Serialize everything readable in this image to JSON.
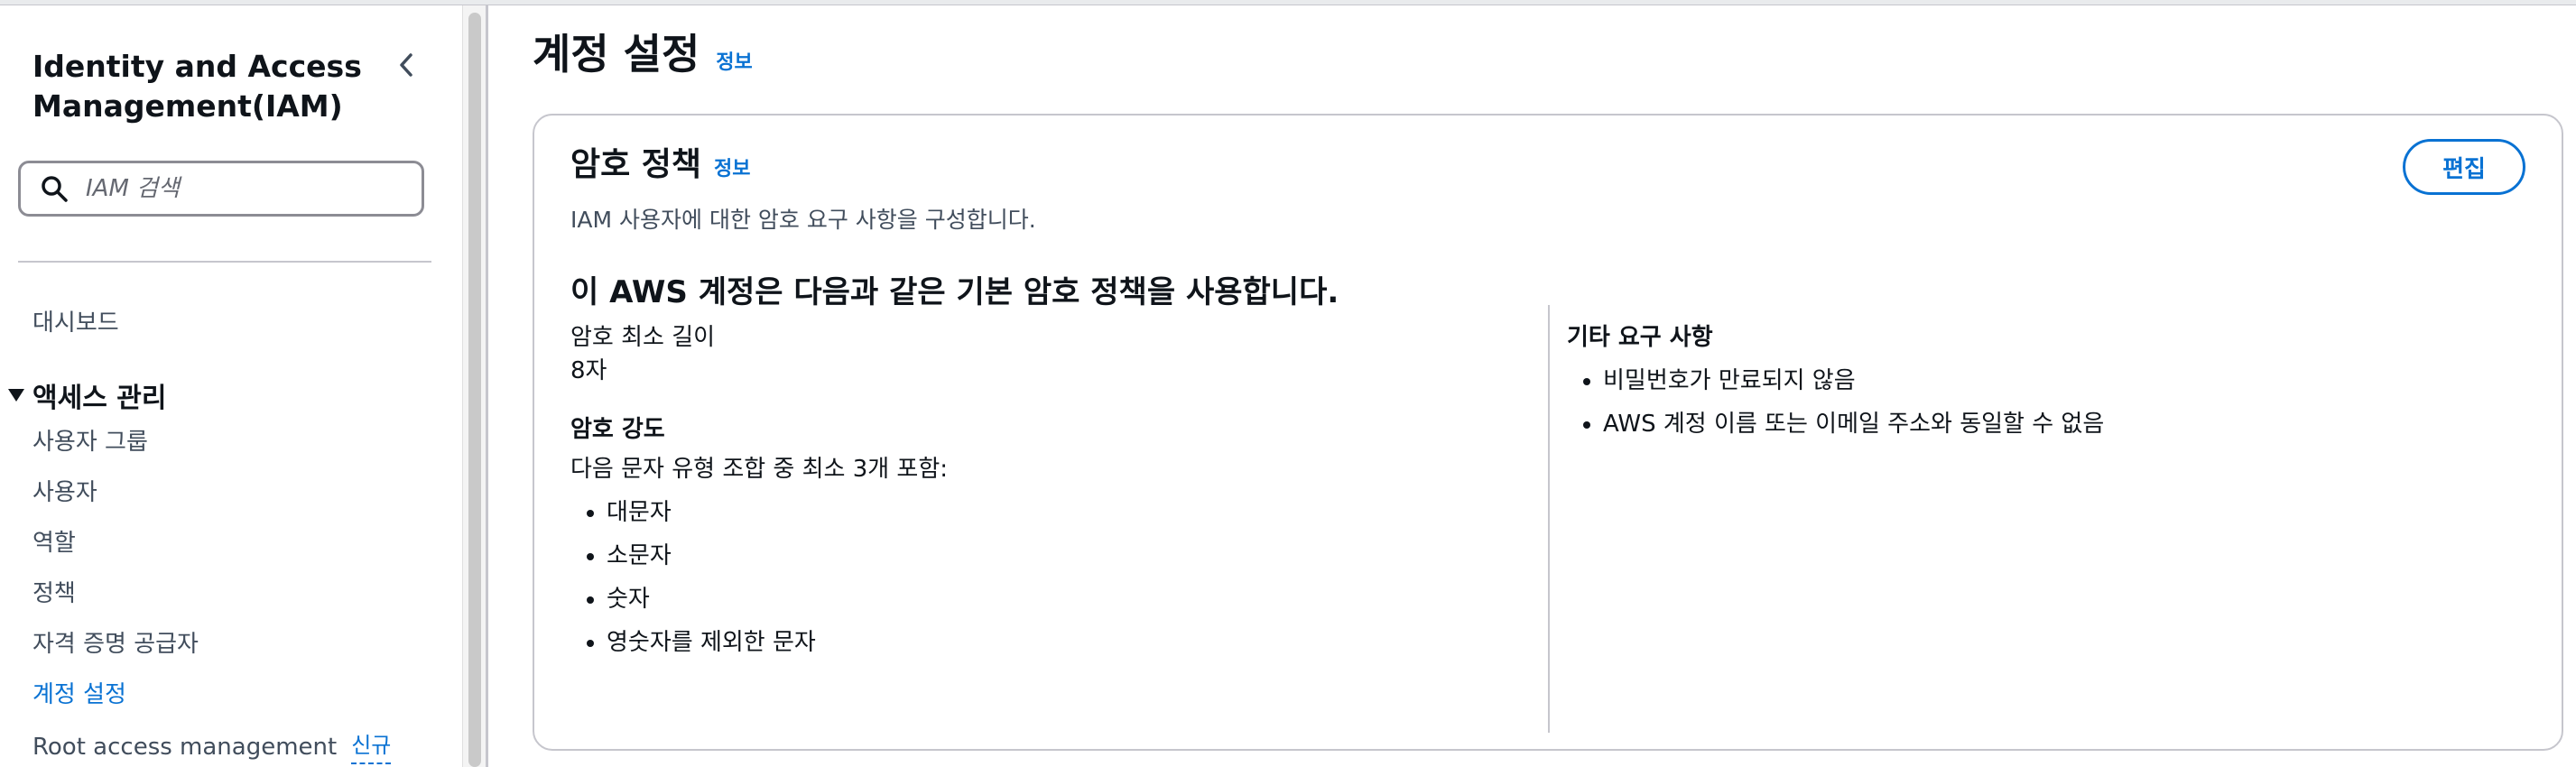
{
  "sidebar": {
    "title": "Identity and Access Management(IAM)",
    "search_placeholder": "IAM 검색",
    "dashboard": "대시보드",
    "section_label": "액세스 관리",
    "items": [
      {
        "label": "사용자 그룹"
      },
      {
        "label": "사용자"
      },
      {
        "label": "역할"
      },
      {
        "label": "정책"
      },
      {
        "label": "자격 증명 공급자"
      },
      {
        "label": "계정 설정",
        "active": true
      },
      {
        "label": "Root access management",
        "badge": "신규"
      }
    ]
  },
  "main": {
    "page_title": "계정 설정",
    "info_label": "정보",
    "card": {
      "title": "암호 정책",
      "info_label": "정보",
      "description": "IAM 사용자에 대한 암호 요구 사항을 구성합니다.",
      "edit_label": "편집",
      "policy_heading": "이 AWS 계정은 다음과 같은 기본 암호 정책을 사용합니다.",
      "min_length_label": "암호 최소 길이",
      "min_length_value": "8자",
      "strength_title": "암호 강도",
      "strength_desc": "다음 문자 유형 조합 중 최소 3개 포함:",
      "strength_items": [
        "대문자",
        "소문자",
        "숫자",
        "영숫자를 제외한 문자"
      ],
      "other_title": "기타 요구 사항",
      "other_items": [
        "비밀번호가 만료되지 않음",
        "AWS 계정 이름 또는 이메일 주소와 동일할 수 없음"
      ]
    }
  },
  "colors": {
    "link": "#0972d3",
    "text": "#0f141a",
    "secondary_text": "#414d5c",
    "border": "#c6c6cd"
  },
  "icons": {
    "collapse": "chevron-left-icon",
    "search": "search-icon",
    "section_toggle": "caret-down-icon"
  }
}
